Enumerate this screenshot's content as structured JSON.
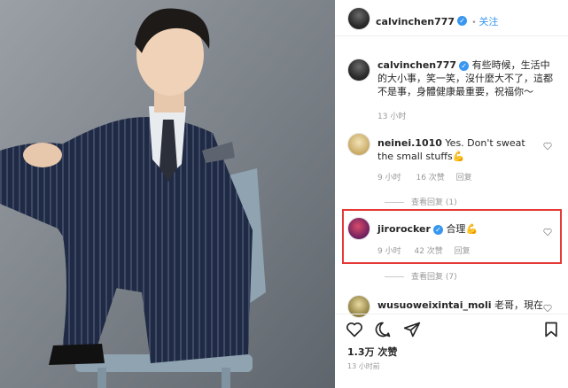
{
  "header": {
    "username": "calvinchen777",
    "follow_label": "关注"
  },
  "caption": {
    "username": "calvinchen777",
    "text": "有些時候，生活中的大小事，笑一笑，沒什麼大不了，這都不是事，身體健康最重要，祝福你～",
    "time": "13 小时"
  },
  "comments": [
    {
      "username": "neinei.1010",
      "text": "Yes. Don't sweat the small stuffs",
      "emoji": "💪",
      "time": "9 小时",
      "likes": "16 次赞",
      "reply": "回复",
      "view_replies": "查看回复 (1)"
    },
    {
      "username": "jirorocker",
      "verified": true,
      "text": "合理",
      "emoji": "💪",
      "time": "9 小时",
      "likes": "42 次赞",
      "reply": "回复",
      "view_replies": "查看回复 (7)"
    },
    {
      "username": "wusuoweixintai_moli",
      "text": "老哥，現在"
    }
  ],
  "footer": {
    "likes": "1.3万 次赞",
    "time": "13 小时前"
  },
  "icons": {
    "heart": "heart-icon",
    "comment": "comment-icon",
    "share": "share-icon",
    "bookmark": "bookmark-icon",
    "verified": "verified-badge-icon"
  },
  "colors": {
    "link": "#3897f0",
    "highlight": "#e53935",
    "meta": "#999999"
  }
}
